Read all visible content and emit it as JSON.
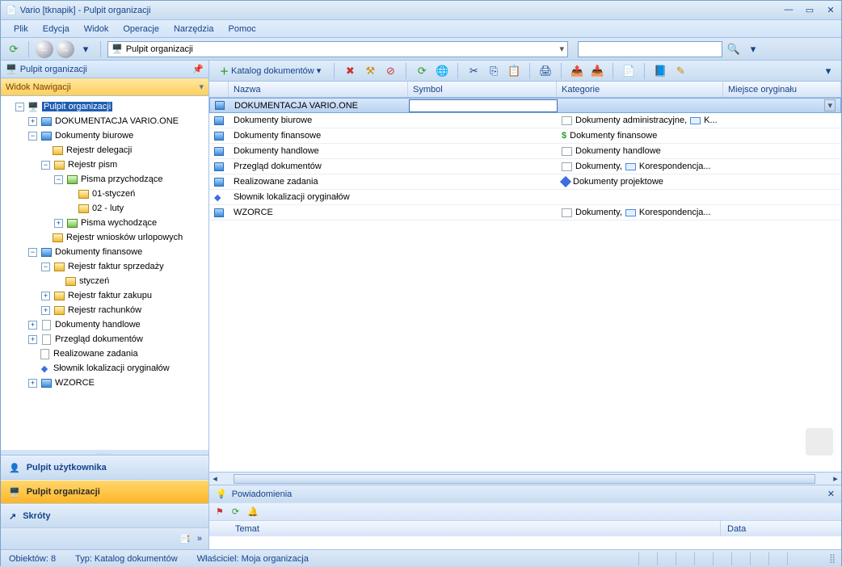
{
  "window": {
    "title": "Vario [tknapik] - Pulpit organizacji"
  },
  "menu": {
    "file": "Plik",
    "edit": "Edycja",
    "view": "Widok",
    "ops": "Operacje",
    "tools": "Narzędzia",
    "help": "Pomoc"
  },
  "address": {
    "value": "Pulpit organizacji"
  },
  "leftPanel": {
    "title": "Pulpit organizacji",
    "navTitle": "Widok Nawigacji",
    "nav": {
      "user": "Pulpit użytkownika",
      "org": "Pulpit organizacji",
      "shortcuts": "Skróty"
    }
  },
  "tree": {
    "root": "Pulpit organizacji",
    "n1": "DOKUMENTACJA VARIO.ONE",
    "n2": "Dokumenty biurowe",
    "n2a": "Rejestr delegacji",
    "n2b": "Rejestr pism",
    "n2b1": "Pisma przychodzące",
    "n2b1a": "01-styczeń",
    "n2b1b": "02 - luty",
    "n2b2": "Pisma wychodzące",
    "n2c": "Rejestr wniosków urlopowych",
    "n3": "Dokumenty finansowe",
    "n3a": "Rejestr faktur sprzedaży",
    "n3a1": "styczeń",
    "n3b": "Rejestr faktur zakupu",
    "n3c": "Rejestr rachunków",
    "n4": "Dokumenty handlowe",
    "n5": "Przegląd dokumentów",
    "n6": "Realizowane zadania",
    "n7": "Słownik lokalizacji oryginałów",
    "n8": "WZORCE"
  },
  "gridToolbar": {
    "catalog": "Katalog dokumentów"
  },
  "columns": {
    "name": "Nazwa",
    "symbol": "Symbol",
    "category": "Kategorie",
    "place": "Miejsce oryginału"
  },
  "rows": [
    {
      "name": "DOKUMENTACJA VARIO.ONE",
      "sym": "",
      "kat": ""
    },
    {
      "name": "Dokumenty biurowe",
      "sym": "",
      "kat": "Dokumenty administracyjne,",
      "kat2": "K..."
    },
    {
      "name": "Dokumenty finansowe",
      "sym": "",
      "kat": "Dokumenty finansowe"
    },
    {
      "name": "Dokumenty handlowe",
      "sym": "",
      "kat": "Dokumenty handlowe"
    },
    {
      "name": "Przegląd dokumentów",
      "sym": "",
      "kat": "Dokumenty,",
      "kat2": "Korespondencja..."
    },
    {
      "name": "Realizowane zadania",
      "sym": "",
      "kat": "Dokumenty projektowe"
    },
    {
      "name": "Słownik lokalizacji oryginałów",
      "sym": "",
      "kat": ""
    },
    {
      "name": "WZORCE",
      "sym": "",
      "kat": "Dokumenty,",
      "kat2": "Korespondencja..."
    }
  ],
  "notif": {
    "title": "Powiadomienia",
    "col1": "Temat",
    "col2": "Data"
  },
  "status": {
    "objects": "Obiektów: 8",
    "type": "Typ: Katalog dokumentów",
    "owner": "Właściciel: Moja organizacja"
  }
}
